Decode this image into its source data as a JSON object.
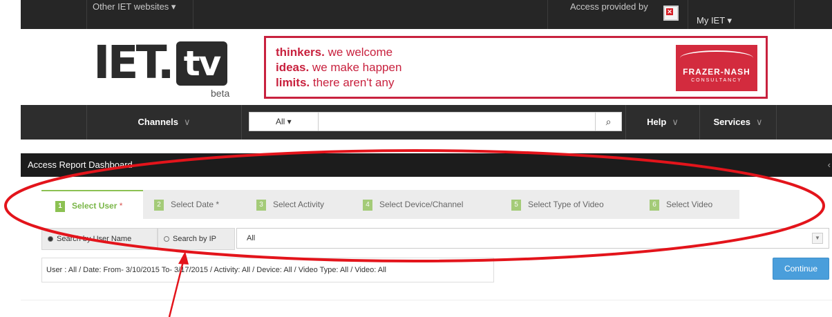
{
  "topbar": {
    "other_sites": "Other IET websites ▾",
    "access_provided": "Access provided by",
    "my_iet": "My IET ▾"
  },
  "logo": {
    "iet": "IET",
    "tv": "tv",
    "dot": ".",
    "beta": "beta"
  },
  "ad": {
    "line1_bold": "thinkers.",
    "line1_rest": " we welcome",
    "line2_bold": "ideas.",
    "line2_rest": " we make happen",
    "line3_bold": "limits.",
    "line3_rest": " there aren't any",
    "brand_name": "FRAZER-NASH",
    "brand_sub": "CONSULTANCY"
  },
  "nav": {
    "channels": "Channels",
    "search_scope": "All ▾",
    "search_placeholder": "",
    "search_icon": "magnifier-icon",
    "help": "Help",
    "services": "Services"
  },
  "dashboard": {
    "title": "Access Report Dashboard",
    "steps": [
      {
        "num": "1",
        "label": "Select User",
        "req": " *"
      },
      {
        "num": "2",
        "label": "Select Date",
        "req": " *"
      },
      {
        "num": "3",
        "label": "Select Activity",
        "req": ""
      },
      {
        "num": "4",
        "label": "Select Device/Channel",
        "req": ""
      },
      {
        "num": "5",
        "label": "Select Type of Video",
        "req": ""
      },
      {
        "num": "6",
        "label": "Select Video",
        "req": ""
      }
    ],
    "search_by_user": "Search by User Name",
    "search_by_ip": "Search by IP",
    "select_value": "All",
    "summary": "User : All / Date: From- 3/10/2015 To- 3/17/2015 / Activity: All / Device: All / Video Type: All / Video: All",
    "continue": "Continue"
  },
  "colors": {
    "accent_green": "#8cc152",
    "annotation_red": "#e3141b",
    "button_blue": "#4a9edb"
  }
}
